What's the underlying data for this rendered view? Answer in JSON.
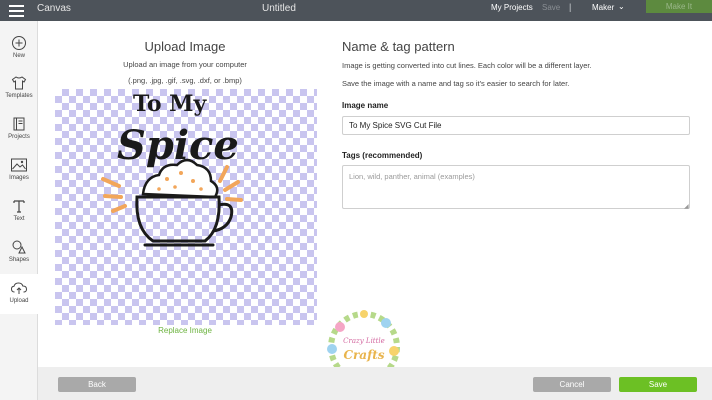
{
  "topbar": {
    "app_title": "Canvas",
    "document_title": "Untitled",
    "my_projects": "My Projects",
    "save": "Save",
    "separator": "|",
    "machine": "Maker",
    "make_it": "Make It"
  },
  "sidebar": {
    "items": [
      {
        "label": "New",
        "icon": "plus-circle-icon"
      },
      {
        "label": "Templates",
        "icon": "shirt-icon"
      },
      {
        "label": "Projects",
        "icon": "book-icon"
      },
      {
        "label": "Images",
        "icon": "image-icon"
      },
      {
        "label": "Text",
        "icon": "text-icon"
      },
      {
        "label": "Shapes",
        "icon": "shapes-icon"
      },
      {
        "label": "Upload",
        "icon": "cloud-upload-icon",
        "active": true
      }
    ]
  },
  "upload_panel": {
    "title": "Upload Image",
    "subtitle": "Upload an image from your computer",
    "formats": "(.png, .jpg, .gif, .svg, .dxf, or .bmp)",
    "preview_art_text": [
      "To My",
      "Spice"
    ],
    "replace_label": "Replace Image"
  },
  "name_tag_panel": {
    "title": "Name & tag pattern",
    "info_line_1": "Image is getting converted into cut lines. Each color will be a different layer.",
    "info_line_2": "Save the image with a name and tag so it's easier to search for later.",
    "image_name_label": "Image name",
    "image_name_value": "To My Spice SVG Cut File",
    "tags_label": "Tags (recommended)",
    "tags_placeholder": "Lion, wild, panther, animal (examples)"
  },
  "watermark": {
    "line1": "Crazy Little",
    "line2": "Crafts"
  },
  "footer": {
    "back": "Back",
    "cancel": "Cancel",
    "save": "Save"
  },
  "colors": {
    "topbar": "#4d535a",
    "accent_green": "#6cc024",
    "link_green": "#6cb33f",
    "checker": "#c9c5ef"
  }
}
